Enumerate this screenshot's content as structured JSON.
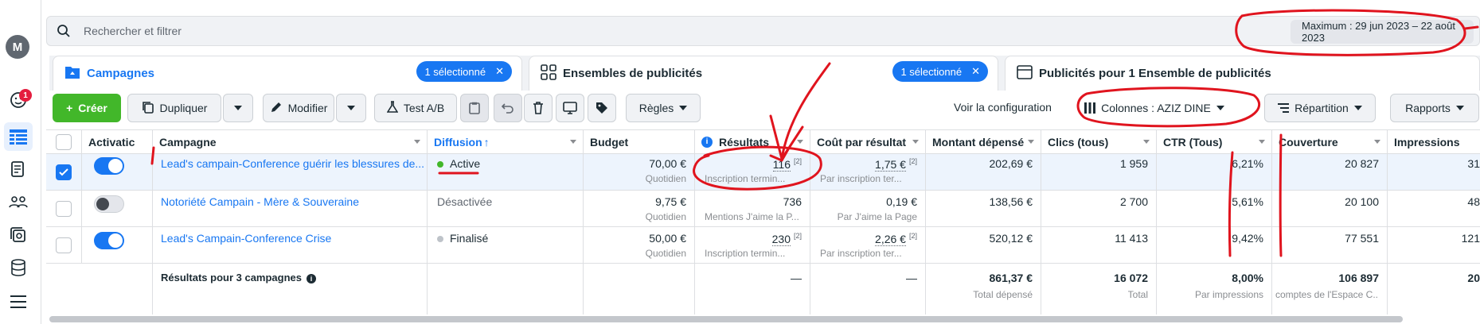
{
  "rail": {
    "avatar_letter": "M",
    "notification_count": "1"
  },
  "search": {
    "placeholder": "Rechercher et filtrer"
  },
  "date_range": "Maximum : 29 jun 2023 – 22 août 2023",
  "tabs": [
    {
      "label": "Campagnes",
      "selected": "1 sélectionné"
    },
    {
      "label": "Ensembles de publicités",
      "selected": "1 sélectionné"
    },
    {
      "label": "Publicités pour 1 Ensemble de publicités"
    }
  ],
  "toolbar": {
    "create": "Créer",
    "duplicate": "Dupliquer",
    "edit": "Modifier",
    "abtest": "Test A/B",
    "rules": "Règles",
    "voir_config": "Voir la configuration",
    "columns": "Colonnes : AZIZ DINE",
    "repartition": "Répartition",
    "reports": "Rapports"
  },
  "table": {
    "headers": {
      "activation": "Activatic",
      "campaign": "Campagne",
      "diffusion": "Diffusion",
      "budget": "Budget",
      "results": "Résultats",
      "cost": "Coût par résultat",
      "spent": "Montant dépensé",
      "clicks": "Clics (tous)",
      "ctr": "CTR (Tous)",
      "reach": "Couverture",
      "impressions": "Impressions"
    },
    "rows": [
      {
        "campaign": "Lead's campain-Conference guérir les blessures de...",
        "diffusion": "Active",
        "budget": "70,00 €",
        "budget_sub": "Quotidien",
        "results": "116",
        "results_sup": "[2]",
        "results_sub": "Inscription termin...",
        "cost": "1,75 €",
        "cost_sup": "[2]",
        "cost_sub": "Par inscription ter...",
        "spent": "202,69 €",
        "clicks": "1 959",
        "ctr": "6,21%",
        "reach": "20 827",
        "impressions": "31"
      },
      {
        "campaign": "Notoriété Campain - Mère & Souveraine",
        "diffusion": "Désactivée",
        "budget": "9,75 €",
        "budget_sub": "Quotidien",
        "results": "736",
        "results_sup": "",
        "results_sub": "Mentions J'aime la P...",
        "cost": "0,19 €",
        "cost_sup": "",
        "cost_sub": "Par J'aime la Page",
        "spent": "138,56 €",
        "clicks": "2 700",
        "ctr": "5,61%",
        "reach": "20 100",
        "impressions": "48"
      },
      {
        "campaign": "Lead's Campain-Conference Crise",
        "diffusion": "Finalisé",
        "budget": "50,00 €",
        "budget_sub": "Quotidien",
        "results": "230",
        "results_sup": "[2]",
        "results_sub": "Inscription termin...",
        "cost": "2,26 €",
        "cost_sup": "[2]",
        "cost_sub": "Par inscription ter...",
        "spent": "520,12 €",
        "clicks": "11 413",
        "ctr": "9,42%",
        "reach": "77 551",
        "impressions": "121"
      }
    ],
    "summary": {
      "label": "Résultats pour 3 campagnes",
      "results": "—",
      "cost": "—",
      "spent": "861,37 €",
      "spent_sub": "Total dépensé",
      "clicks": "16 072",
      "clicks_sub": "Total",
      "ctr": "8,00%",
      "ctr_sub": "Par impressions",
      "reach": "106 897",
      "reach_sub": "comptes de l'Espace C...",
      "impressions": "20"
    }
  },
  "colors": {
    "accent": "#1877f2",
    "create_green": "#42b72a",
    "annotation_red": "#e0141e",
    "active_green": "#42b72a"
  }
}
